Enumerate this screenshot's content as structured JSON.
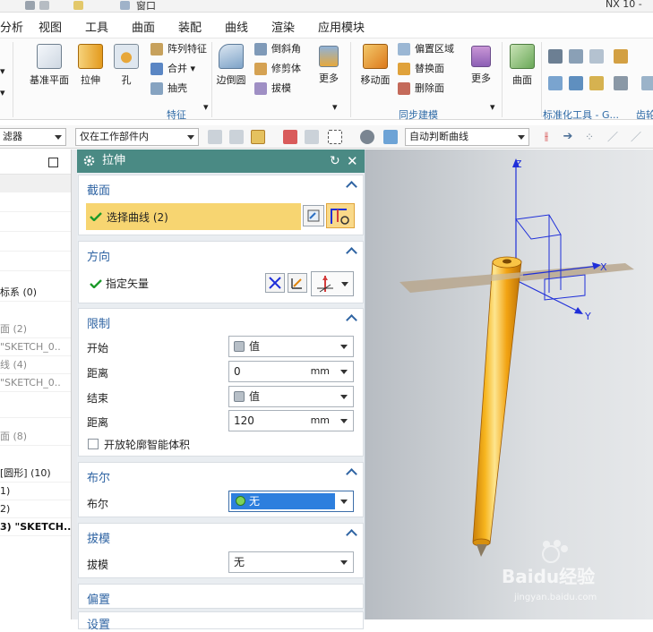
{
  "window": {
    "top_label": "窗口",
    "product_label": "NX 10 -"
  },
  "menu": [
    "分析",
    "视图",
    "工具",
    "曲面",
    "装配",
    "曲线",
    "渲染",
    "应用模块"
  ],
  "ribbon": {
    "feature_group": {
      "large": [
        "基准平面",
        "拉伸",
        "孔"
      ],
      "small": [
        "阵列特征",
        "合并",
        "抽壳"
      ],
      "label": "特征"
    },
    "edge_group": {
      "large": [
        "边倒圆"
      ],
      "small": [
        "倒斜角",
        "修剪体",
        "拔模"
      ],
      "more": "更多"
    },
    "sync_group": {
      "large": [
        "移动面"
      ],
      "small": [
        "偏置区域",
        "替换面",
        "删除面"
      ],
      "more": "更多",
      "label": "同步建模"
    },
    "surface_group": {
      "large": [
        "曲面"
      ]
    },
    "std_label": "标准化工具 - G...",
    "gear_label": "齿轮"
  },
  "filterbar": {
    "filter_combo": "滤器",
    "scope_combo": "仅在工作部件内",
    "curve_rule_combo": "自动判断曲线"
  },
  "navigator": {
    "rows": [
      {
        "text": "标系 (0)",
        "dim": false
      },
      {
        "text": "面 (2)",
        "dim": true
      },
      {
        "text": "\"SKETCH_0..",
        "dim": true
      },
      {
        "text": "线 (4)",
        "dim": true
      },
      {
        "text": "\"SKETCH_0..",
        "dim": true
      },
      {
        "text": "面 (8)",
        "dim": true
      },
      {
        "text": "[圆形] (10)",
        "dim": false
      },
      {
        "text": "1)",
        "dim": false
      },
      {
        "text": "2)",
        "dim": false
      },
      {
        "text": "3) \"SKETCH..",
        "dim": false,
        "bold": true
      }
    ]
  },
  "dialog": {
    "title": "拉伸",
    "sections": {
      "section": {
        "title": "截面",
        "select_curve": "选择曲线 (2)"
      },
      "direction": {
        "title": "方向",
        "specify_vector": "指定矢量"
      },
      "limits": {
        "title": "限制",
        "start_label": "开始",
        "start_value": "值",
        "start_distance_label": "距离",
        "start_distance": "0",
        "end_label": "结束",
        "end_value": "值",
        "end_distance_label": "距离",
        "end_distance": "120",
        "unit": "mm",
        "open_profile": "开放轮廓智能体积"
      },
      "boolean": {
        "title": "布尔",
        "label": "布尔",
        "value": "无"
      },
      "draft": {
        "title": "拔模",
        "label": "拔模",
        "value": "无"
      },
      "offset": {
        "title": "偏置"
      },
      "settings": {
        "title": "设置"
      }
    }
  },
  "viewport": {
    "axis_x": "X",
    "axis_y": "Y",
    "axis_z": "Z",
    "watermark_logo": "Baidu经验",
    "watermark_url": "jingyan.baidu.com"
  },
  "colors": {
    "dialog_header": "#4a8a84",
    "section_title": "#2f64a3",
    "selection_highlight": "#f7d571",
    "boolean_highlight": "#2d7fde",
    "solid_body": "#f3a310",
    "axis": "#1f2fd9"
  }
}
